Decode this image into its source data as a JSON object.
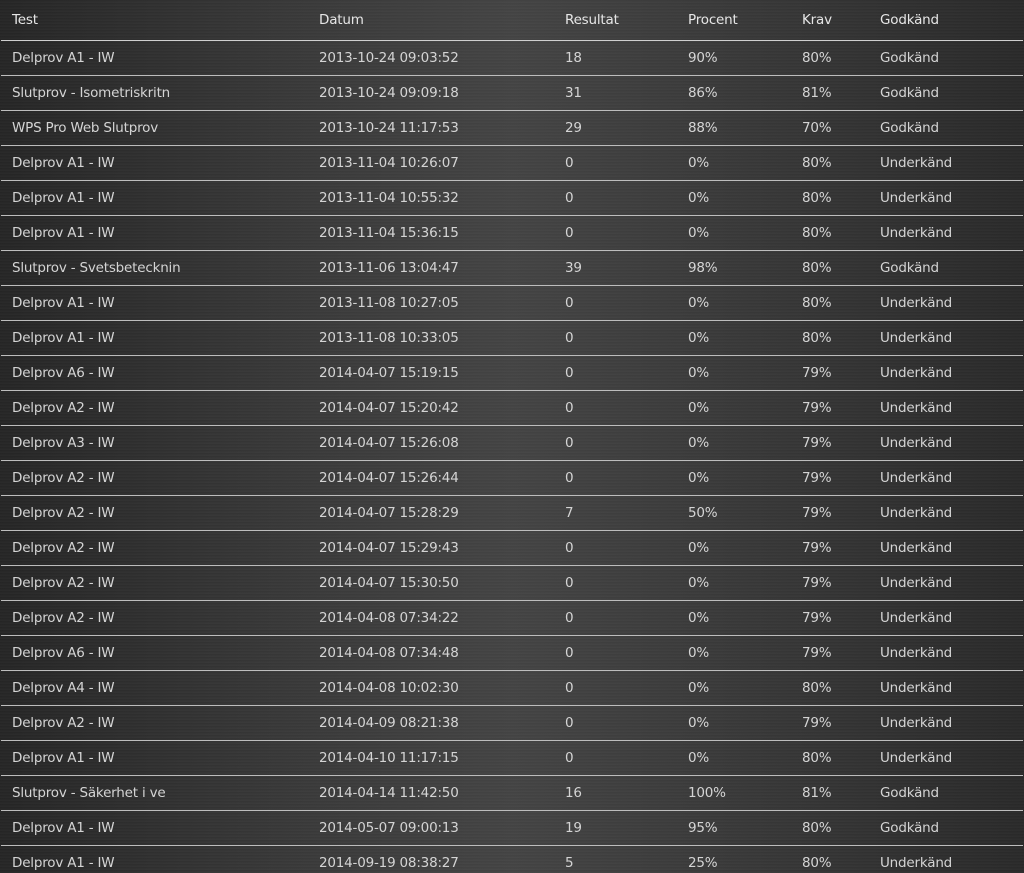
{
  "table": {
    "headers": {
      "test": "Test",
      "datum": "Datum",
      "resultat": "Resultat",
      "procent": "Procent",
      "krav": "Krav",
      "godkand": "Godkänd"
    },
    "rows": [
      {
        "test": "Delprov A1 - IW",
        "datum": "2013-10-24 09:03:52",
        "resultat": "18",
        "procent": "90%",
        "krav": "80%",
        "godkand": "Godkänd"
      },
      {
        "test": "Slutprov - Isometriskritn",
        "datum": "2013-10-24 09:09:18",
        "resultat": "31",
        "procent": "86%",
        "krav": "81%",
        "godkand": "Godkänd"
      },
      {
        "test": "WPS Pro Web Slutprov",
        "datum": "2013-10-24 11:17:53",
        "resultat": "29",
        "procent": "88%",
        "krav": "70%",
        "godkand": "Godkänd"
      },
      {
        "test": "Delprov A1 - IW",
        "datum": "2013-11-04 10:26:07",
        "resultat": "0",
        "procent": "0%",
        "krav": "80%",
        "godkand": "Underkänd"
      },
      {
        "test": "Delprov A1 - IW",
        "datum": "2013-11-04 10:55:32",
        "resultat": "0",
        "procent": "0%",
        "krav": "80%",
        "godkand": "Underkänd"
      },
      {
        "test": "Delprov A1 - IW",
        "datum": "2013-11-04 15:36:15",
        "resultat": "0",
        "procent": "0%",
        "krav": "80%",
        "godkand": "Underkänd"
      },
      {
        "test": "Slutprov - Svetsbetecknin",
        "datum": "2013-11-06 13:04:47",
        "resultat": "39",
        "procent": "98%",
        "krav": "80%",
        "godkand": "Godkänd"
      },
      {
        "test": "Delprov A1 - IW",
        "datum": "2013-11-08 10:27:05",
        "resultat": "0",
        "procent": "0%",
        "krav": "80%",
        "godkand": "Underkänd"
      },
      {
        "test": "Delprov A1 - IW",
        "datum": "2013-11-08 10:33:05",
        "resultat": "0",
        "procent": "0%",
        "krav": "80%",
        "godkand": "Underkänd"
      },
      {
        "test": "Delprov A6 - IW",
        "datum": "2014-04-07 15:19:15",
        "resultat": "0",
        "procent": "0%",
        "krav": "79%",
        "godkand": "Underkänd"
      },
      {
        "test": "Delprov A2 - IW",
        "datum": "2014-04-07 15:20:42",
        "resultat": "0",
        "procent": "0%",
        "krav": "79%",
        "godkand": "Underkänd"
      },
      {
        "test": "Delprov A3 - IW",
        "datum": "2014-04-07 15:26:08",
        "resultat": "0",
        "procent": "0%",
        "krav": "79%",
        "godkand": "Underkänd"
      },
      {
        "test": "Delprov A2 - IW",
        "datum": "2014-04-07 15:26:44",
        "resultat": "0",
        "procent": "0%",
        "krav": "79%",
        "godkand": "Underkänd"
      },
      {
        "test": "Delprov A2 - IW",
        "datum": "2014-04-07 15:28:29",
        "resultat": "7",
        "procent": "50%",
        "krav": "79%",
        "godkand": "Underkänd"
      },
      {
        "test": "Delprov A2 - IW",
        "datum": "2014-04-07 15:29:43",
        "resultat": "0",
        "procent": "0%",
        "krav": "79%",
        "godkand": "Underkänd"
      },
      {
        "test": "Delprov A2 - IW",
        "datum": "2014-04-07 15:30:50",
        "resultat": "0",
        "procent": "0%",
        "krav": "79%",
        "godkand": "Underkänd"
      },
      {
        "test": "Delprov A2 - IW",
        "datum": "2014-04-08 07:34:22",
        "resultat": "0",
        "procent": "0%",
        "krav": "79%",
        "godkand": "Underkänd"
      },
      {
        "test": "Delprov A6 - IW",
        "datum": "2014-04-08 07:34:48",
        "resultat": "0",
        "procent": "0%",
        "krav": "79%",
        "godkand": "Underkänd"
      },
      {
        "test": "Delprov A4 - IW",
        "datum": "2014-04-08 10:02:30",
        "resultat": "0",
        "procent": "0%",
        "krav": "80%",
        "godkand": "Underkänd"
      },
      {
        "test": "Delprov A2 - IW",
        "datum": "2014-04-09 08:21:38",
        "resultat": "0",
        "procent": "0%",
        "krav": "79%",
        "godkand": "Underkänd"
      },
      {
        "test": "Delprov A1 - IW",
        "datum": "2014-04-10 11:17:15",
        "resultat": "0",
        "procent": "0%",
        "krav": "80%",
        "godkand": "Underkänd"
      },
      {
        "test": "Slutprov - Säkerhet i ve",
        "datum": "2014-04-14 11:42:50",
        "resultat": "16",
        "procent": "100%",
        "krav": "81%",
        "godkand": "Godkänd"
      },
      {
        "test": "Delprov A1 - IW",
        "datum": "2014-05-07 09:00:13",
        "resultat": "19",
        "procent": "95%",
        "krav": "80%",
        "godkand": "Godkänd"
      },
      {
        "test": "Delprov A1 - IW",
        "datum": "2014-09-19 08:38:27",
        "resultat": "5",
        "procent": "25%",
        "krav": "80%",
        "godkand": "Underkänd"
      }
    ]
  }
}
